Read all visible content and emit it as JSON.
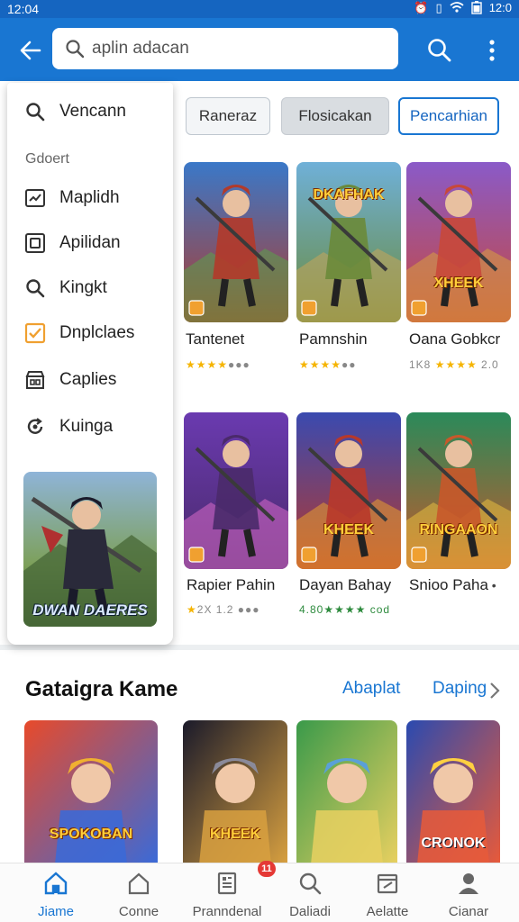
{
  "status_bar": {
    "time": "12:04",
    "right_time": "12:0",
    "icons": [
      "alarm-icon",
      "vibrate-icon",
      "wifi-icon",
      "battery-icon"
    ]
  },
  "app_bar": {
    "search_value": "aplin adacan",
    "back_icon": "arrow-left-icon",
    "search_icon": "search-icon",
    "menu_icon": "more-vert-icon"
  },
  "drawer": {
    "top_item": {
      "label": "Vencann",
      "icon": "search-icon"
    },
    "section_label": "Gdoert",
    "items": [
      {
        "label": "Maplidh",
        "icon": "chart-icon"
      },
      {
        "label": "Apilidan",
        "icon": "app-square-icon"
      },
      {
        "label": "Kingkt",
        "icon": "search-icon"
      },
      {
        "label": "Dnplclaes",
        "icon": "checkbox-icon"
      },
      {
        "label": "Caplies",
        "icon": "store-icon"
      },
      {
        "label": "Kuinga",
        "icon": "refresh-icon"
      }
    ],
    "promo_title": "DWAN DAERES"
  },
  "chips": [
    "Raneraz",
    "Flosicakan",
    "Pencarhian"
  ],
  "games": [
    {
      "title": "Tantenet",
      "rating": "★★★★●●●",
      "caption": "",
      "colors": [
        "#3a78c8",
        "#5aa24a",
        "#b23a2a"
      ]
    },
    {
      "title": "Pamnshin",
      "rating": "★★★★●●",
      "caption": "DKAFHAK",
      "colors": [
        "#6fb0d8",
        "#c9a55a",
        "#6a8a3a"
      ]
    },
    {
      "title": "Oana Gobkcr",
      "rating": "1K8 ★★★★ 2.0",
      "caption": "XHEEK",
      "colors": [
        "#8a5ac8",
        "#d8a040",
        "#c8483a"
      ]
    },
    {
      "title": "Rapier Pahin",
      "rating": "★2X 1.2 ●●●",
      "caption": "",
      "colors": [
        "#6a3ab0",
        "#d86ac8",
        "#4a2a6a"
      ]
    },
    {
      "title": "Dayan Bahay",
      "rating": "4.80★★★★ cod",
      "caption": "KHEEK",
      "colors": [
        "#3a4ab0",
        "#e8a030",
        "#b8382a"
      ]
    },
    {
      "title": "Snioo Paha",
      "rating": "",
      "caption": "RINGAAON",
      "colors": [
        "#2a8a5a",
        "#e8c040",
        "#c8582a"
      ]
    }
  ],
  "category_section": {
    "title": "Gataigra Kame",
    "link1": "Abaplat",
    "link2": "Daping",
    "cards": [
      {
        "caption": "SPOKOBAN",
        "colors": [
          "#e84a2a",
          "#3a6ad8",
          "#f0b030"
        ]
      },
      {
        "caption": "KHEEK",
        "colors": [
          "#1a1a2a",
          "#d8a040",
          "#8a8a9a"
        ]
      },
      {
        "caption": "",
        "colors": [
          "#3a9a4a",
          "#e8d060",
          "#5aa0d8"
        ]
      },
      {
        "caption": "CRONOK",
        "colors": [
          "#2a4ab0",
          "#e85a3a",
          "#ffd040"
        ]
      }
    ]
  },
  "bottom_nav": [
    {
      "label": "Jiame",
      "icon": "home-icon",
      "active": true
    },
    {
      "label": "Conne",
      "icon": "house-outline-icon",
      "active": false
    },
    {
      "label": "Pranndenal",
      "icon": "document-icon",
      "active": false
    },
    {
      "label": "Daliadi",
      "icon": "search-icon",
      "active": false
    },
    {
      "label": "Aelatte",
      "icon": "edit-box-icon",
      "active": false
    },
    {
      "label": "Cianar",
      "icon": "person-icon",
      "active": false
    }
  ],
  "badge": "11",
  "colors": {
    "primary": "#1976d2",
    "status_bar": "#1565c0",
    "star": "#f5b400",
    "badge": "#e53935"
  }
}
